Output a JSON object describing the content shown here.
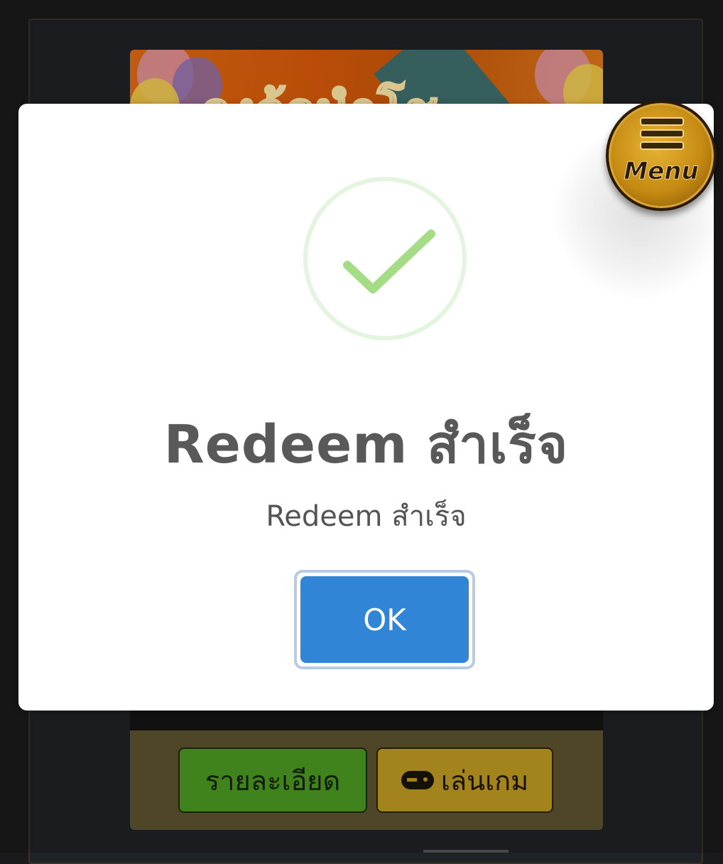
{
  "background": {
    "banner_text": "กงล้อนำโช",
    "details_button": "รายละเอียด",
    "play_button": "เล่นเกม"
  },
  "modal": {
    "title": "Redeem สำเร็จ",
    "text": "Redeem สำเร็จ",
    "ok_button": "OK",
    "icon": "success-check-icon",
    "accent_color": "#3085d6",
    "check_color": "#a5dc86"
  },
  "menu": {
    "label": "Menu",
    "icon": "hamburger-icon"
  }
}
